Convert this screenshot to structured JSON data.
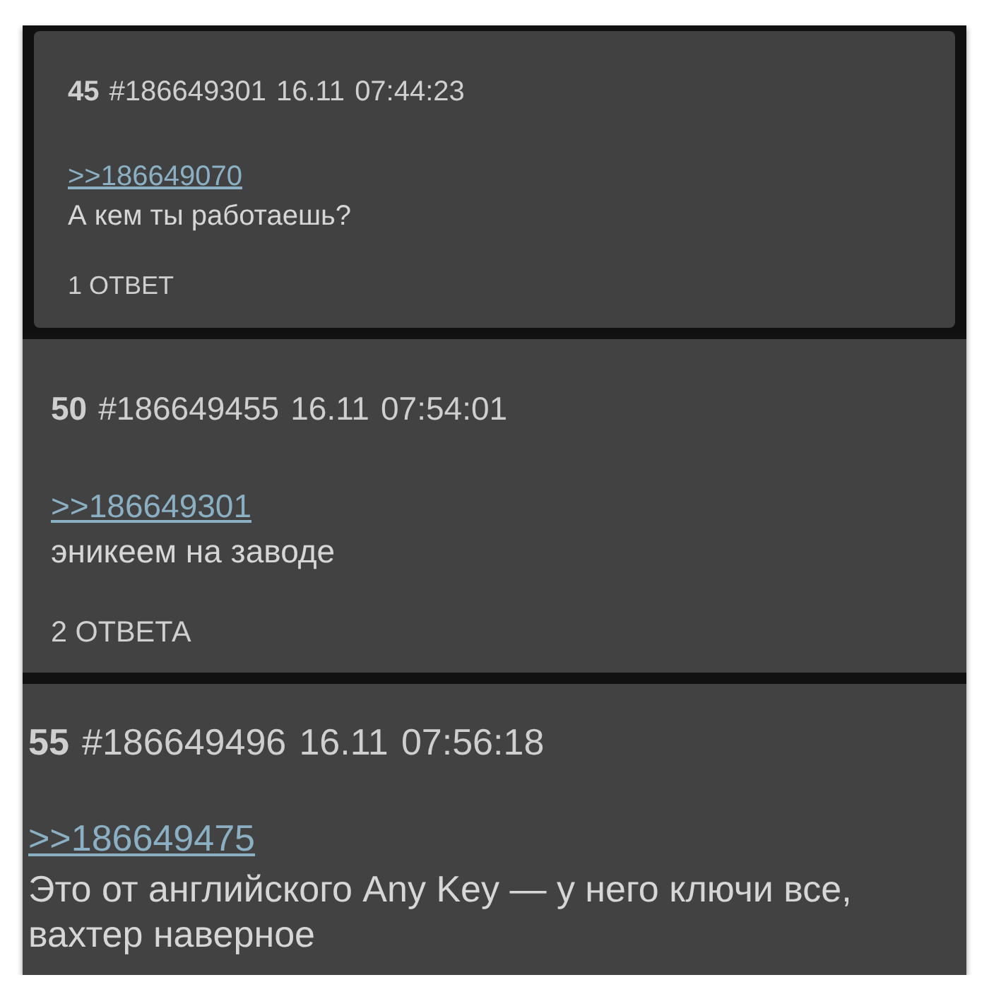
{
  "posts": [
    {
      "number": "45",
      "id": "#186649301",
      "date": "16.11",
      "time": "07:44:23",
      "reply_to": ">>186649070",
      "text": "А кем ты работаешь?",
      "replies": "1 ОТВЕТ",
      "highlighted": true
    },
    {
      "number": "50",
      "id": "#186649455",
      "date": "16.11",
      "time": "07:54:01",
      "reply_to": ">>186649301",
      "text": "эникеем на заводе",
      "replies": "2 ОТВЕТА",
      "highlighted": false
    },
    {
      "number": "55",
      "id": "#186649496",
      "date": "16.11",
      "time": "07:56:18",
      "reply_to": ">>186649475",
      "text": "Это от английского Any Key — у него ключи все, вахтер наверное",
      "highlighted": false
    }
  ]
}
